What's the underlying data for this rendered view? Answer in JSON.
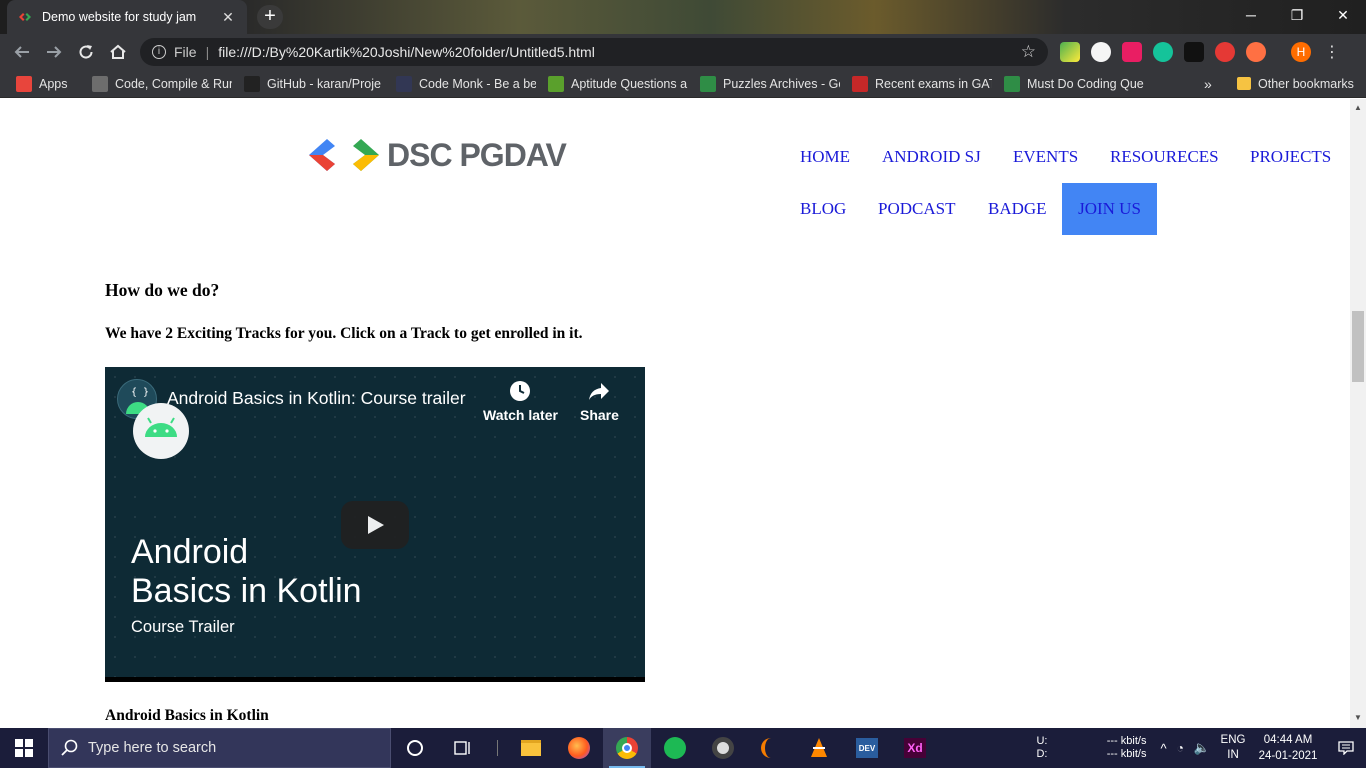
{
  "browser": {
    "tab_title": "Demo website for study jam",
    "tab_close": "✕",
    "new_tab": "+",
    "window_controls": {
      "minimize": "─",
      "restore": "❐",
      "close": "✕"
    },
    "omnibox": {
      "scheme_label": "File",
      "url": "file:///D:/By%20Kartik%20Joshi/New%20folder/Untitled5.html"
    },
    "profile_initial": "H",
    "bookmarks": [
      {
        "label": "Apps",
        "icon": "apps-grid-icon",
        "color": "#e8453c"
      },
      {
        "label": "Code, Compile & Run",
        "icon": "codechef-icon",
        "color": "#6d6d6d"
      },
      {
        "label": "GitHub - karan/Proje",
        "icon": "github-icon",
        "color": "#222222"
      },
      {
        "label": "Code Monk - Be a be",
        "icon": "hackerearth-icon",
        "color": "#323754"
      },
      {
        "label": "Aptitude Questions a",
        "icon": "leaf-icon",
        "color": "#5aa02c"
      },
      {
        "label": "Puzzles Archives - Ge",
        "icon": "geeksforgeeks-icon",
        "color": "#2f8d46"
      },
      {
        "label": "Recent exams in GATE",
        "icon": "question-icon",
        "color": "#c62828"
      },
      {
        "label": "Must Do Coding Que",
        "icon": "geeksforgeeks-icon",
        "color": "#2f8d46"
      }
    ],
    "bookmarks_overflow": "»",
    "other_bookmarks": "Other bookmarks"
  },
  "site": {
    "logo_text": "DSC PGDAV",
    "nav": [
      "HOME",
      "ANDROID SJ",
      "EVENTS",
      "RESOURECES",
      "PROJECTS",
      "BLOG",
      "PODCAST",
      "BADGE"
    ],
    "join_label": "JOIN US",
    "heading": "How do we do?",
    "subheading": "We have 2 Exciting Tracks for you. Click on a Track to get enrolled in it.",
    "video": {
      "title": "Android Basics in Kotlin: Course trailer",
      "watch_later": "Watch later",
      "share": "Share",
      "big_title_line1": "Android",
      "big_title_line2": "Basics in Kotlin",
      "subtitle": "Course Trailer"
    },
    "video_caption": "Android Basics in Kotlin"
  },
  "taskbar": {
    "search_placeholder": "Type here to search",
    "apps": [
      "task-view-icon",
      "file-explorer-icon",
      "firefox-icon",
      "chrome-icon",
      "spotify-icon",
      "media-player-icon",
      "eclipse-icon",
      "vlc-icon",
      "dev-cpp-icon",
      "adobe-xd-icon"
    ],
    "net_up_label": "U:",
    "net_down_label": "D:",
    "net_up_value": "--- kbit/s",
    "net_down_value": "--- kbit/s",
    "language": "ENG",
    "region": "IN",
    "time": "04:44 AM",
    "date": "24-01-2021"
  },
  "colors": {
    "link": "#1a1ad8",
    "join_bg": "#4285f4",
    "chrome_dark": "#35363a",
    "taskbar": "#1b1d3a"
  }
}
